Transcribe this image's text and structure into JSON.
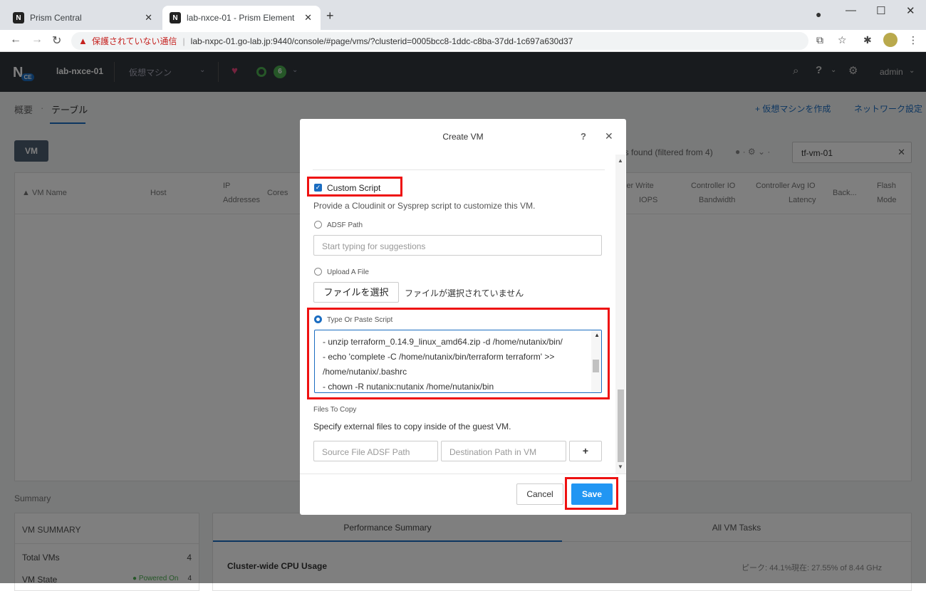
{
  "browser": {
    "tabs": [
      {
        "title": "Prism Central"
      },
      {
        "title": "lab-nxce-01 - Prism Element"
      }
    ],
    "security_warning": "保護されていない通信",
    "url": "lab-nxpc-01.go-lab.jp:9440/console/#page/vms/?clusterid=0005bcc8-1ddc-c8ba-37dd-1c697a630d37"
  },
  "header": {
    "cluster": "lab-nxce-01",
    "menu": "仮想マシン",
    "alert_count": "6",
    "user": "admin"
  },
  "subnav": {
    "overview": "概要",
    "table": "テーブル",
    "create_vm": "+ 仮想マシンを作成",
    "network_settings": "ネットワーク設定"
  },
  "toolbar": {
    "vm_button": "VM",
    "filter_text": "es found (filtered from 4)",
    "search_value": "tf-vm-01"
  },
  "table": {
    "headers": {
      "vm_name": "VM Name",
      "host": "Host",
      "ip1": "IP",
      "ip2": "Addresses",
      "cores": "Cores",
      "writeiops1": "ler Write",
      "writeiops2": "IOPS",
      "bw1": "Controller IO",
      "bw2": "Bandwidth",
      "lat1": "Controller Avg IO",
      "lat2": "Latency",
      "backup": "Back...",
      "flash1": "Flash",
      "flash2": "Mode"
    }
  },
  "summary": {
    "title": "Summary",
    "vm_summary": "VM SUMMARY",
    "total_vms_label": "Total VMs",
    "total_vms": "4",
    "vm_state_label": "VM State",
    "powered_on_label": "● Powered On",
    "powered_on": "4"
  },
  "performance": {
    "tab_perf": "Performance Summary",
    "tab_tasks": "All VM Tasks",
    "cpu_title": "Cluster-wide CPU Usage",
    "peak": "ピーク: 44.1%",
    "current": "現在: 27.55% of 8.44 GHz"
  },
  "modal": {
    "title": "Create VM",
    "help": "?",
    "custom_script_label": "Custom Script",
    "custom_script_desc": "Provide a Cloudinit or Sysprep script to customize this VM.",
    "adsf_path_label": "ADSF Path",
    "adsf_path_placeholder": "Start typing for suggestions",
    "upload_file_label": "Upload A File",
    "choose_file": "ファイルを選択",
    "no_file": "ファイルが選択されていません",
    "type_paste_label": "Type Or Paste Script",
    "script_lines": [
      "- unzip terraform_0.14.9_linux_amd64.zip -d /home/nutanix/bin/",
      "- echo 'complete -C /home/nutanix/bin/terraform terraform' >>",
      "/home/nutanix/.bashrc",
      "- chown -R nutanix:nutanix /home/nutanix/bin"
    ],
    "files_to_copy_label": "Files To Copy",
    "files_to_copy_desc": "Specify external files to copy inside of the guest VM.",
    "source_placeholder": "Source File ADSF Path",
    "dest_placeholder": "Destination Path in VM",
    "add": "+",
    "cancel": "Cancel",
    "save": "Save"
  },
  "colors": {
    "accent": "#1b6dc1",
    "save_button": "#2196f3",
    "highlight": "#e11111",
    "header_bg": "#31373d"
  }
}
